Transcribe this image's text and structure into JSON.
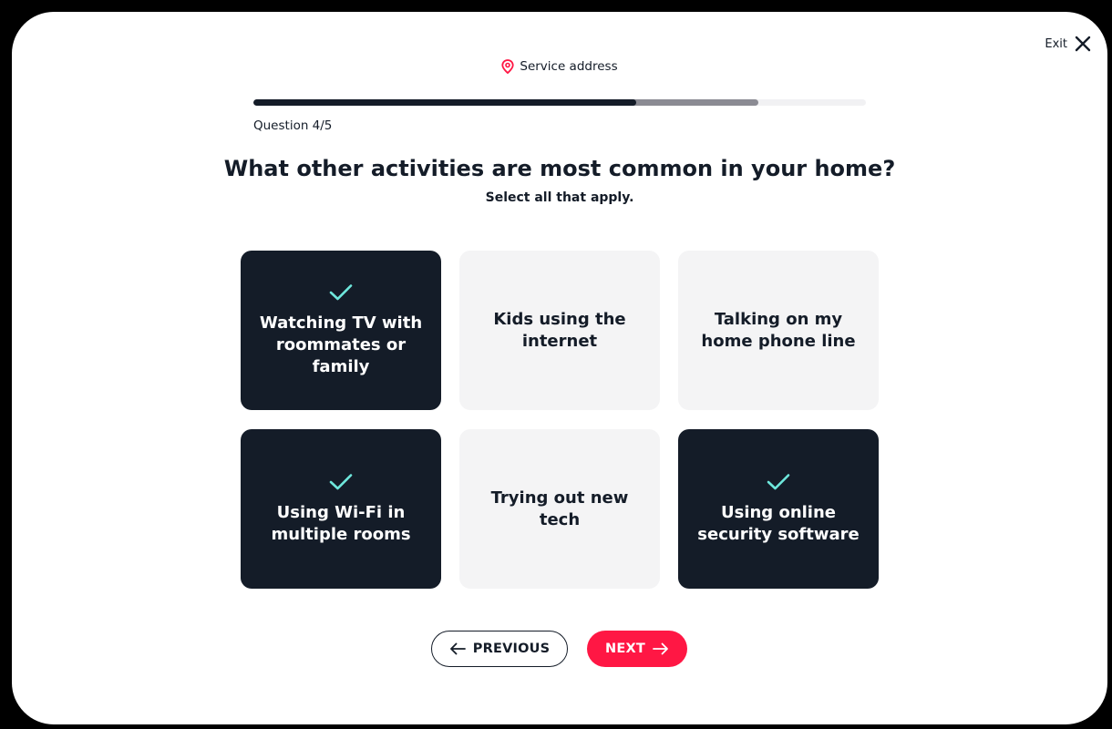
{
  "header": {
    "exit_label": "Exit",
    "service_address_label": "Service address"
  },
  "progress": {
    "question_label": "Question 4/5",
    "completed_fraction": 0.625,
    "in_progress_fraction": 0.825
  },
  "question": {
    "title": "What other activities are most common in your home?",
    "subtitle": "Select all that apply."
  },
  "options": [
    {
      "label": "Watching TV with roommates or family",
      "selected": true
    },
    {
      "label": "Kids using the internet",
      "selected": false
    },
    {
      "label": "Talking on my home phone line",
      "selected": false
    },
    {
      "label": "Using Wi-Fi in multiple rooms",
      "selected": true
    },
    {
      "label": "Trying out new tech",
      "selected": false
    },
    {
      "label": "Using online security software",
      "selected": true
    }
  ],
  "buttons": {
    "previous_label": "PREVIOUS",
    "next_label": "NEXT"
  },
  "colors": {
    "dark": "#141c28",
    "accent": "#ff1744",
    "check": "#6ee7dc",
    "card_unselected": "#f4f4f5",
    "progress_in_progress": "#8b8b93",
    "progress_track": "#f1f1f3"
  },
  "icons": {
    "exit": "close-icon",
    "service": "map-pin-icon",
    "selected": "check-icon",
    "previous": "arrow-left-icon",
    "next": "arrow-right-icon"
  }
}
